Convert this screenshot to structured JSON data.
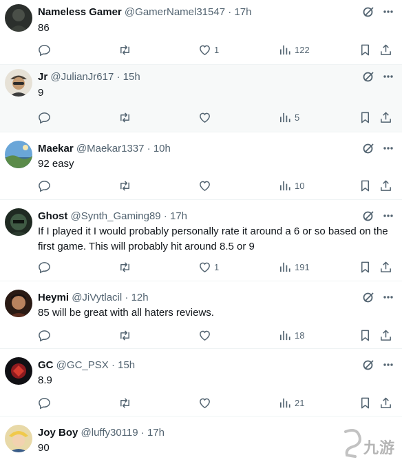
{
  "colors": {
    "text": "#0f1419",
    "secondary": "#536471",
    "divider": "#eff3f4",
    "highlight_bg": "#f7f9f9"
  },
  "tweets": [
    {
      "name": "Nameless Gamer",
      "handle": "@GamerNamel31547",
      "dot": "·",
      "time": "17h",
      "text": "86",
      "replies": "",
      "retweets": "",
      "likes": "1",
      "views": "122",
      "avatar": "dark-figure"
    },
    {
      "name": "Jr",
      "handle": "@JulianJr617",
      "dot": "·",
      "time": "15h",
      "text": "9",
      "replies": "",
      "retweets": "",
      "likes": "",
      "views": "5",
      "avatar": "man-with-cap"
    },
    {
      "name": "Maekar",
      "handle": "@Maekar1337",
      "dot": "·",
      "time": "10h",
      "text": "92 easy",
      "replies": "",
      "retweets": "",
      "likes": "",
      "views": "10",
      "avatar": "blue-landscape"
    },
    {
      "name": "Ghost",
      "handle": "@Synth_Gaming89",
      "dot": "·",
      "time": "17h",
      "text": "If I played it I would probably personally rate it around a 6 or so based on the first game. This will probably hit around 8.5 or 9",
      "replies": "",
      "retweets": "",
      "likes": "1",
      "views": "191",
      "avatar": "green-helmet"
    },
    {
      "name": "Heymi",
      "handle": "@JiVytlacil",
      "dot": "·",
      "time": "12h",
      "text": "85 will be great with all haters reviews.",
      "replies": "",
      "retweets": "",
      "likes": "",
      "views": "18",
      "avatar": "fighter-portrait"
    },
    {
      "name": "GC",
      "handle": "@GC_PSX",
      "dot": "·",
      "time": "15h",
      "text": "8.9",
      "replies": "",
      "retweets": "",
      "likes": "",
      "views": "21",
      "avatar": "red-symbol"
    },
    {
      "name": "Joy Boy",
      "handle": "@luffy30119",
      "dot": "·",
      "time": "17h",
      "text": "90",
      "replies": "",
      "retweets": "",
      "likes": "",
      "views": "",
      "avatar": "anime-character"
    }
  ],
  "icons": {
    "reply": "reply-icon",
    "retweet": "retweet-icon",
    "like": "heart-icon",
    "views": "views-icon",
    "bookmark": "bookmark-icon",
    "share": "share-icon",
    "grok": "grok-icon",
    "more": "more-icon"
  },
  "watermark": "九游"
}
